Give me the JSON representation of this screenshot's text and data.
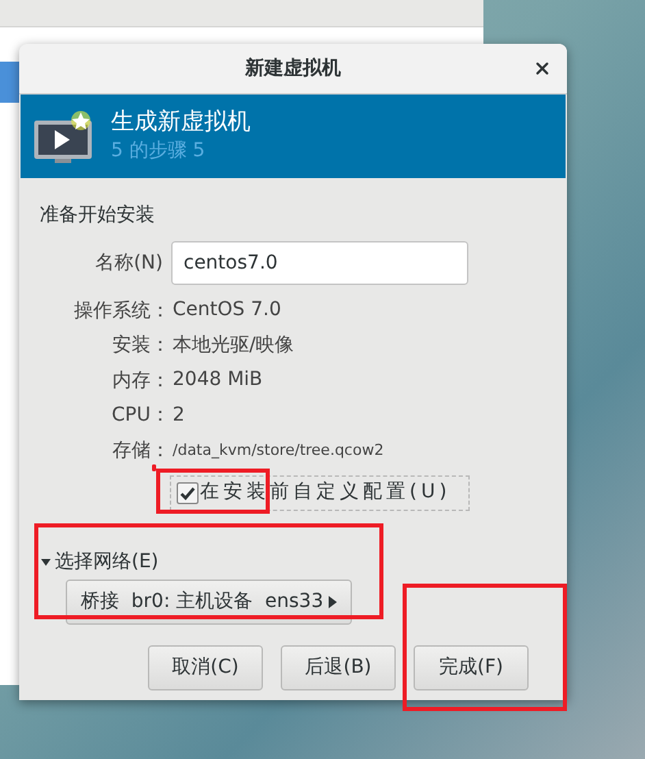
{
  "dialog": {
    "title": "新建虚拟机",
    "header": {
      "title": "生成新虚拟机",
      "subtitle": "5 的步骤 5"
    },
    "section": "准备开始安装",
    "name_field": {
      "label": "名称(N)",
      "value": "centos7.0"
    },
    "details": [
      {
        "label": "操作系统：",
        "value": "CentOS 7.0",
        "kind": "text"
      },
      {
        "label": "安装：",
        "value": "本地光驱/映像",
        "kind": "text"
      },
      {
        "label": "内存：",
        "value": "2048 MiB",
        "kind": "text"
      },
      {
        "label": "CPU：",
        "value": "2",
        "kind": "text"
      },
      {
        "label": "存储：",
        "value": "/data_kvm/store/tree.qcow2",
        "kind": "path"
      }
    ],
    "customize_checkbox": {
      "label": "在安装前自定义配置(U)",
      "checked": true
    },
    "network": {
      "label": "选择网络(E)",
      "expanded": true,
      "selection": "桥接  br0: 主机设备  ens33"
    },
    "buttons": [
      "取消(C)",
      "后退(B)",
      "完成(F)"
    ]
  }
}
